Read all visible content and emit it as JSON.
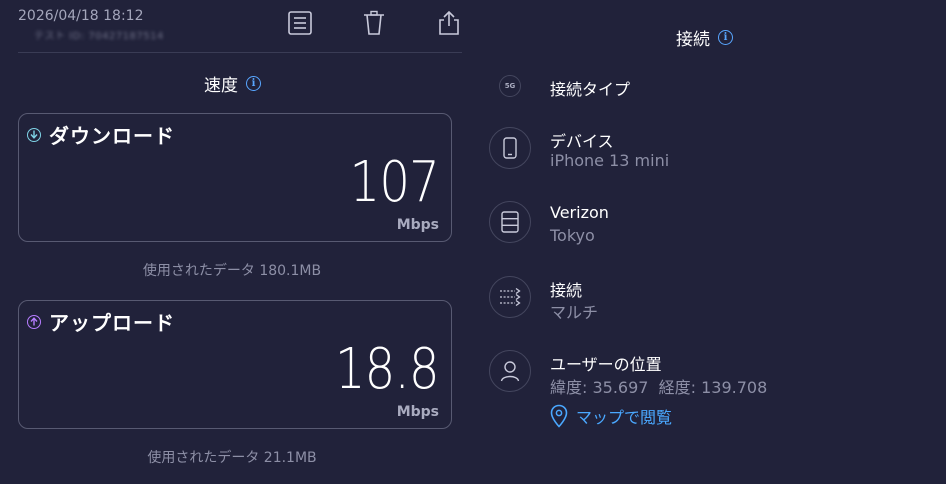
{
  "header": {
    "timestamp": "2026/04/18 18:12",
    "test_id": "テスト ID: 70427187514"
  },
  "toolbar": {
    "icons": [
      "list-icon",
      "trash-icon",
      "share-icon"
    ]
  },
  "speed_section": {
    "title": "速度"
  },
  "download": {
    "label": "ダウンロード",
    "value": "107",
    "unit": "Mbps",
    "data_used": "使用されたデータ 180.1MB",
    "icon_color": "#7fd3e6"
  },
  "upload": {
    "label": "アップロード",
    "value": "18.8",
    "unit": "Mbps",
    "data_used": "使用されたデータ 21.1MB",
    "icon_color": "#b67dff"
  },
  "connection_section": {
    "title": "接続",
    "rows": [
      {
        "label": "接続タイプ",
        "sub": "",
        "icon": "5g-icon"
      },
      {
        "label": "デバイス",
        "sub": "iPhone 13 mini",
        "icon": "phone-icon"
      },
      {
        "label": "Verizon",
        "sub": "Tokyo",
        "icon": "server-icon"
      },
      {
        "label": "接続",
        "sub": "マルチ",
        "icon": "multi-connection-icon"
      },
      {
        "label": "ユーザーの位置",
        "sub": "緯度: 35.697  経度: 139.708",
        "icon": "user-icon"
      }
    ],
    "map_link": "マップで閲覧"
  },
  "colors": {
    "background": "#21223a",
    "accent": "#4aa8ff",
    "card_border": "#585a72"
  }
}
